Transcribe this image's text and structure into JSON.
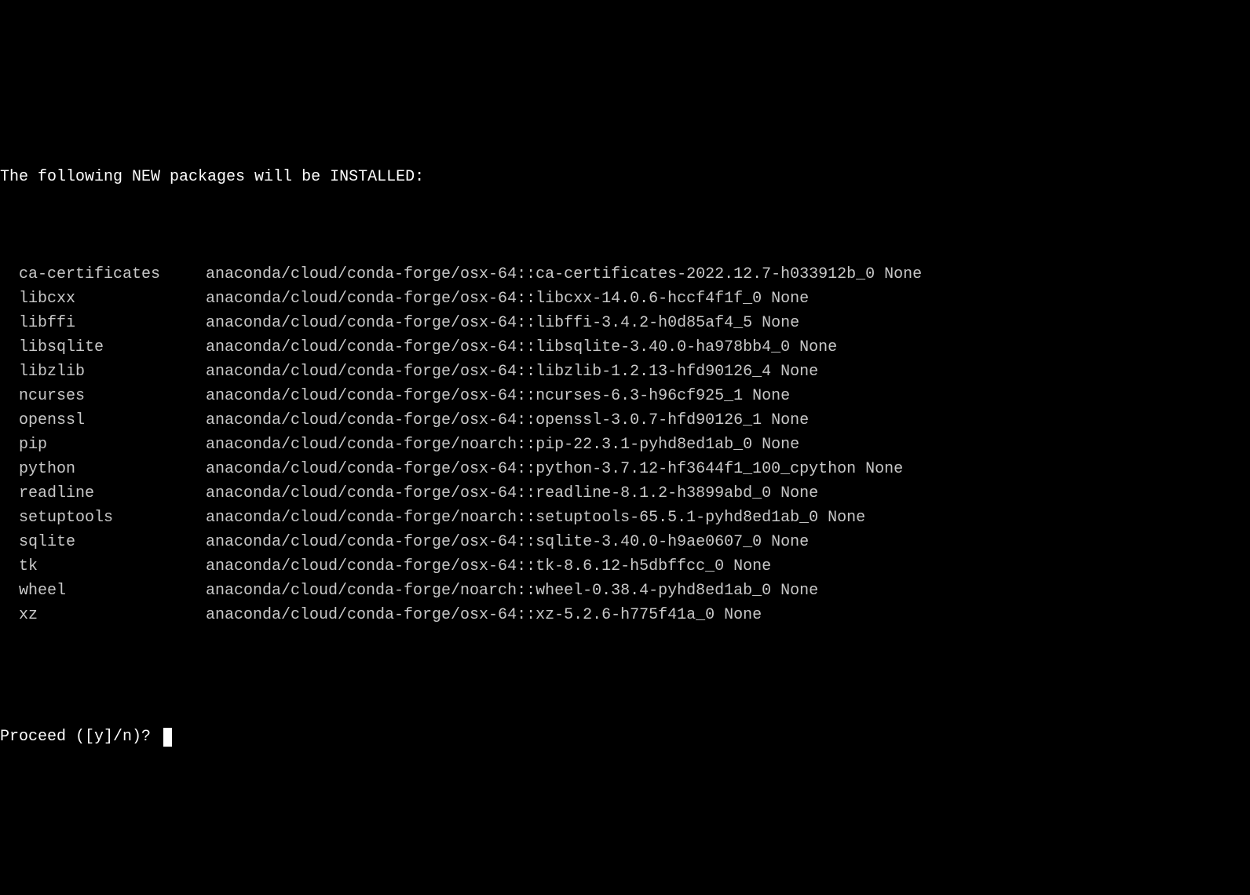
{
  "header": "The following NEW packages will be INSTALLED:",
  "packages": [
    {
      "name": "ca-certificates",
      "spec": "anaconda/cloud/conda-forge/osx-64::ca-certificates-2022.12.7-h033912b_0 None"
    },
    {
      "name": "libcxx",
      "spec": "anaconda/cloud/conda-forge/osx-64::libcxx-14.0.6-hccf4f1f_0 None"
    },
    {
      "name": "libffi",
      "spec": "anaconda/cloud/conda-forge/osx-64::libffi-3.4.2-h0d85af4_5 None"
    },
    {
      "name": "libsqlite",
      "spec": "anaconda/cloud/conda-forge/osx-64::libsqlite-3.40.0-ha978bb4_0 None"
    },
    {
      "name": "libzlib",
      "spec": "anaconda/cloud/conda-forge/osx-64::libzlib-1.2.13-hfd90126_4 None"
    },
    {
      "name": "ncurses",
      "spec": "anaconda/cloud/conda-forge/osx-64::ncurses-6.3-h96cf925_1 None"
    },
    {
      "name": "openssl",
      "spec": "anaconda/cloud/conda-forge/osx-64::openssl-3.0.7-hfd90126_1 None"
    },
    {
      "name": "pip",
      "spec": "anaconda/cloud/conda-forge/noarch::pip-22.3.1-pyhd8ed1ab_0 None"
    },
    {
      "name": "python",
      "spec": "anaconda/cloud/conda-forge/osx-64::python-3.7.12-hf3644f1_100_cpython None"
    },
    {
      "name": "readline",
      "spec": "anaconda/cloud/conda-forge/osx-64::readline-8.1.2-h3899abd_0 None"
    },
    {
      "name": "setuptools",
      "spec": "anaconda/cloud/conda-forge/noarch::setuptools-65.5.1-pyhd8ed1ab_0 None"
    },
    {
      "name": "sqlite",
      "spec": "anaconda/cloud/conda-forge/osx-64::sqlite-3.40.0-h9ae0607_0 None"
    },
    {
      "name": "tk",
      "spec": "anaconda/cloud/conda-forge/osx-64::tk-8.6.12-h5dbffcc_0 None"
    },
    {
      "name": "wheel",
      "spec": "anaconda/cloud/conda-forge/noarch::wheel-0.38.4-pyhd8ed1ab_0 None"
    },
    {
      "name": "xz",
      "spec": "anaconda/cloud/conda-forge/osx-64::xz-5.2.6-h775f41a_0 None"
    }
  ],
  "prompt": "Proceed ([y]/n)? "
}
